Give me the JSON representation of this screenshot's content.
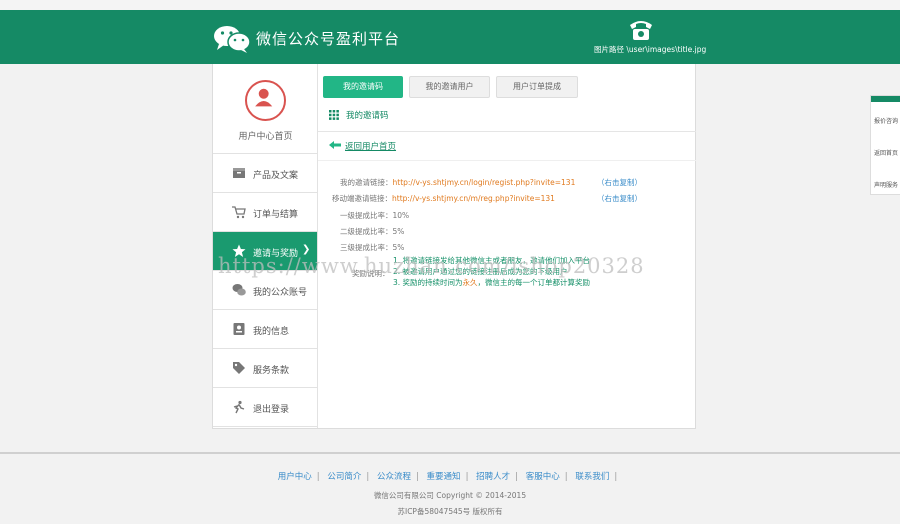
{
  "header": {
    "title": "微信公众号盈利平台",
    "image_path_note": "图片路径 \\user\\images\\title.jpg",
    "brand_color": "#158a65"
  },
  "sidebar": {
    "user_home": "用户中心首页",
    "items": [
      {
        "label": "产品及文案",
        "icon": "box-icon",
        "active": false
      },
      {
        "label": "订单与结算",
        "icon": "cart-icon",
        "active": false
      },
      {
        "label": "邀请与奖励",
        "icon": "star-icon",
        "active": true
      },
      {
        "label": "我的公众账号",
        "icon": "wechat-icon",
        "active": false
      },
      {
        "label": "我的信息",
        "icon": "id-card-icon",
        "active": false
      },
      {
        "label": "服务条款",
        "icon": "tag-icon",
        "active": false
      },
      {
        "label": "退出登录",
        "icon": "logout-icon",
        "active": false
      }
    ],
    "active_arrow": "❯"
  },
  "tabs": [
    "我的邀请码",
    "我的邀请用户",
    "用户订单提成"
  ],
  "section_title": "我的邀请码",
  "back_link": "返回用户首页",
  "invite": {
    "link_label": "我的邀请链接：",
    "link_url": "http://v-ys.shtjmy.cn/login/regist.php?invite=131",
    "mobile_label": "移动端邀请链接：",
    "mobile_url": "http://v-ys.shtjmy.cn/m/reg.php?invite=131",
    "copy_label": "（右击复制）",
    "rate1": "一级提成比率：10%",
    "rate2": "二级提成比率：5%",
    "rate3": "三级提成比率：5%",
    "tip_label": "奖励说明：",
    "tip1": "1. 将邀请链接发给其他微信主或者朋友，邀请他们加入平台",
    "tip2": "2. 被邀请用户通过您的链接注册后成为您的下级用户",
    "tip3_prefix": "3. 奖励的持续时间为",
    "tip3_highlight": "永久",
    "tip3_suffix": "，微信主的每一个订单都计算奖励"
  },
  "watermark": "https://www.huzhan.com/ishop20328",
  "side_panel": [
    "报价咨询",
    "返回首页",
    "声明服务"
  ],
  "footer": {
    "links": [
      "用户中心",
      "公司简介",
      "公众流程",
      "重要通知",
      "招聘人才",
      "客服中心",
      "联系我们"
    ],
    "copyright": "微信公司有限公司    Copyright © 2014-2015",
    "icp": "苏ICP备58047545号 版权所有"
  }
}
